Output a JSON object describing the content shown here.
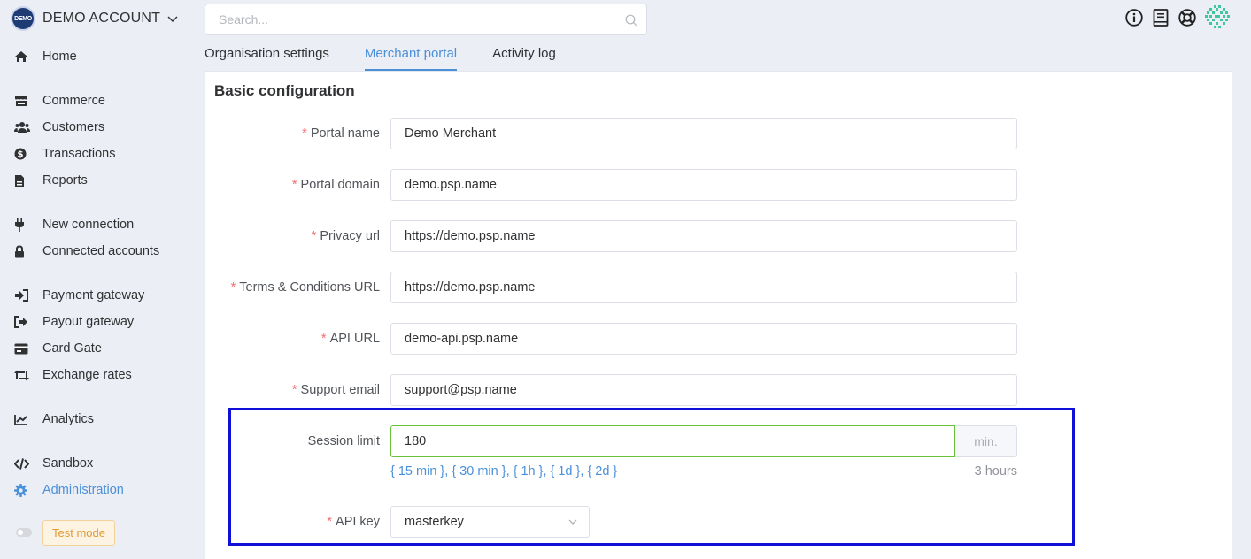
{
  "account": {
    "logo_text": "DEMO",
    "name": "DEMO ACCOUNT"
  },
  "search": {
    "placeholder": "Search..."
  },
  "sidebar": {
    "items": [
      {
        "label": "Home",
        "icon": "home-icon"
      },
      {
        "label": "Commerce",
        "icon": "store-icon"
      },
      {
        "label": "Customers",
        "icon": "users-icon"
      },
      {
        "label": "Transactions",
        "icon": "dollar-circle-icon"
      },
      {
        "label": "Reports",
        "icon": "file-icon"
      },
      {
        "label": "New connection",
        "icon": "plug-icon"
      },
      {
        "label": "Connected accounts",
        "icon": "lock-icon"
      },
      {
        "label": "Payment gateway",
        "icon": "sign-in-icon"
      },
      {
        "label": "Payout gateway",
        "icon": "sign-out-icon"
      },
      {
        "label": "Card Gate",
        "icon": "credit-card-icon"
      },
      {
        "label": "Exchange rates",
        "icon": "retweet-icon"
      },
      {
        "label": "Analytics",
        "icon": "chart-line-icon"
      },
      {
        "label": "Sandbox",
        "icon": "code-icon"
      },
      {
        "label": "Administration",
        "icon": "gear-icon",
        "active": true
      }
    ],
    "test_mode": "Test mode"
  },
  "tabs": [
    {
      "label": "Organisation settings"
    },
    {
      "label": "Merchant portal",
      "active": true
    },
    {
      "label": "Activity log"
    }
  ],
  "section": {
    "title": "Basic configuration"
  },
  "form": {
    "portal_name": {
      "label": "Portal name",
      "value": "Demo Merchant",
      "required": true
    },
    "portal_domain": {
      "label": "Portal domain",
      "value": "demo.psp.name",
      "required": true
    },
    "privacy_url": {
      "label": "Privacy url",
      "value": "https://demo.psp.name",
      "required": true
    },
    "terms_url": {
      "label": "Terms & Conditions URL",
      "value": "https://demo.psp.name",
      "required": true
    },
    "api_url": {
      "label": "API URL",
      "value": "demo-api.psp.name",
      "required": true
    },
    "support_email": {
      "label": "Support email",
      "value": "support@psp.name",
      "required": true
    },
    "session_limit": {
      "label": "Session limit",
      "value": "180",
      "unit": "min.",
      "presets": [
        "{ 15 min }",
        "{ 30 min }",
        "{ 1h }",
        "{ 1d }",
        "{ 2d }"
      ],
      "hint": "3 hours"
    },
    "api_key": {
      "label": "API key",
      "value": "masterkey",
      "required": true
    }
  },
  "colors": {
    "accent": "#4a90d9",
    "required": "#f56c6c",
    "highlight": "#1010d8",
    "valid": "#67c23a"
  }
}
